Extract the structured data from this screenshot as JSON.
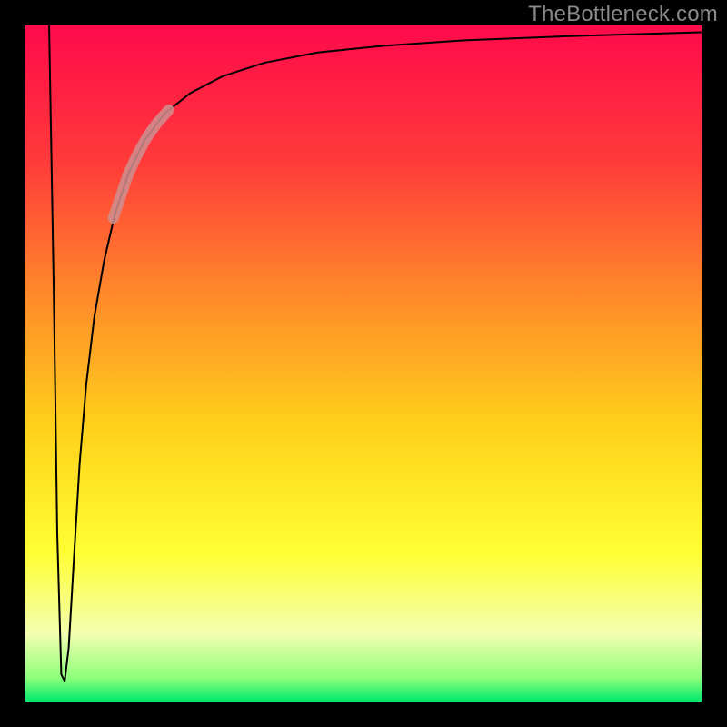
{
  "watermark": "TheBottleneck.com",
  "chart_data": {
    "type": "line",
    "title": "",
    "xlabel": "",
    "ylabel": "",
    "xlim": [
      0,
      100
    ],
    "ylim": [
      0,
      100
    ],
    "grid": false,
    "legend": false,
    "background": {
      "type": "vertical-gradient",
      "stops": [
        {
          "pos": 0.0,
          "color": "#ff0a4b"
        },
        {
          "pos": 0.2,
          "color": "#ff3a3a"
        },
        {
          "pos": 0.4,
          "color": "#ff8a2a"
        },
        {
          "pos": 0.6,
          "color": "#ffd31a"
        },
        {
          "pos": 0.78,
          "color": "#ffff33"
        },
        {
          "pos": 0.9,
          "color": "#f3ffb0"
        },
        {
          "pos": 0.965,
          "color": "#8dff7a"
        },
        {
          "pos": 1.0,
          "color": "#00e86b"
        }
      ]
    },
    "series": [
      {
        "name": "bottleneck-curve",
        "x": [
          3.5,
          4.2,
          4.7,
          5.3,
          5.8,
          6.4,
          7.1,
          8.0,
          9.0,
          10.2,
          11.6,
          13.2,
          15.2,
          17.6,
          20.6,
          24.4,
          29.2,
          35.4,
          43.2,
          53.0,
          65.0,
          80.0,
          100.0
        ],
        "y": [
          100,
          60,
          25,
          4,
          3,
          8,
          20,
          35,
          47,
          57,
          65,
          72,
          78,
          83,
          87,
          90,
          92.5,
          94.5,
          96,
          97,
          97.8,
          98.4,
          99
        ],
        "stroke": "#000000",
        "stroke_width": 2
      },
      {
        "name": "highlight-segment",
        "x": [
          13.0,
          14.0,
          15.2,
          16.5,
          18.0,
          19.5,
          21.2
        ],
        "y": [
          71.5,
          74.5,
          78.0,
          80.8,
          83.5,
          85.6,
          87.5
        ],
        "stroke": "#cf8f8f",
        "stroke_width": 12,
        "opacity": 0.85
      }
    ]
  }
}
